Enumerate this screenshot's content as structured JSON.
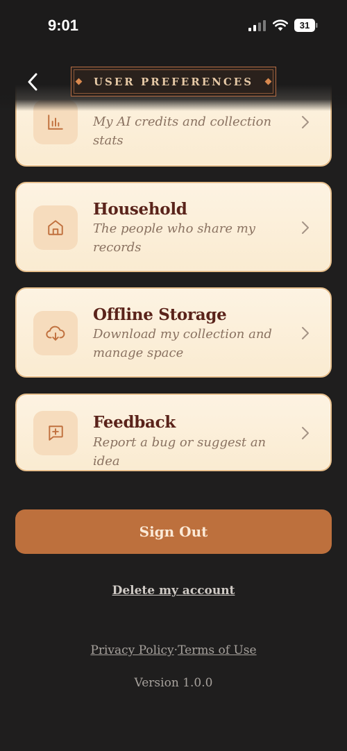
{
  "status_bar": {
    "time": "9:01",
    "battery": "31"
  },
  "header": {
    "title": "USER PREFERENCES",
    "back_icon": "chevron-left-icon"
  },
  "cards": [
    {
      "title": "",
      "subtitle": "My AI credits and collection stats",
      "icon": "bar-chart-icon"
    },
    {
      "title": "Household",
      "subtitle": "The people who share my records",
      "icon": "home-icon"
    },
    {
      "title": "Offline Storage",
      "subtitle": "Download my collection and manage space",
      "icon": "cloud-download-icon"
    },
    {
      "title": "Feedback",
      "subtitle": "Report a bug or suggest an idea",
      "icon": "message-plus-icon"
    }
  ],
  "actions": {
    "sign_out": "Sign Out",
    "delete_account": "Delete my account"
  },
  "footer": {
    "privacy": "Privacy Policy",
    "separator": "·",
    "terms": "Terms of Use",
    "version": "Version 1.0.0"
  },
  "colors": {
    "accent": "#bd703d",
    "card_bg": "#fdf3e2",
    "card_border": "#e8c08d",
    "title": "#5a231a",
    "background": "#1f1e1e"
  }
}
